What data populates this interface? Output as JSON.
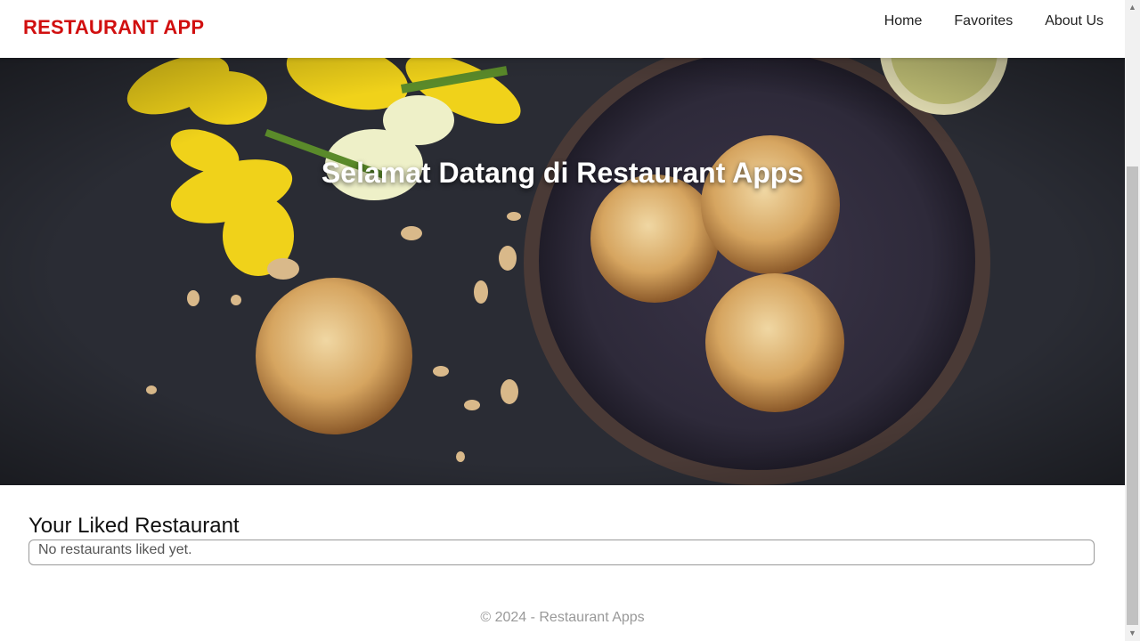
{
  "header": {
    "logo": "RESTAURANT APP",
    "nav": [
      {
        "label": "Home"
      },
      {
        "label": "Favorites"
      },
      {
        "label": "About Us"
      }
    ]
  },
  "hero": {
    "title": "Selamat Datang di Restaurant Apps"
  },
  "liked": {
    "title": "Your Liked Restaurant",
    "empty_message": "No restaurants liked yet."
  },
  "footer": {
    "text": "© 2024 - Restaurant Apps"
  },
  "colors": {
    "brand": "#d10f0f"
  }
}
